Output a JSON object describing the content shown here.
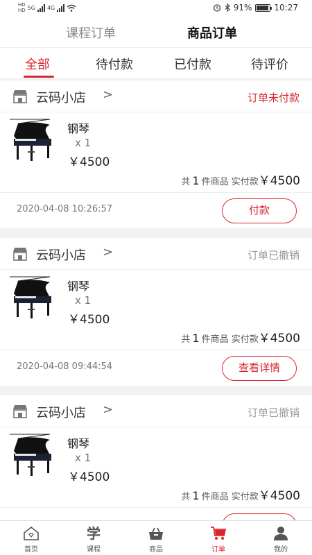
{
  "status_bar": {
    "left_hd_top": "HD",
    "left_hd_bottom": "HD",
    "net_label_1": "5G",
    "net_label_2": "4G",
    "battery_percent": "91%",
    "battery_level": 0.91,
    "time": "10:27"
  },
  "top_tabs": {
    "course_label": "课程订单",
    "goods_label": "商品订单",
    "active": "goods"
  },
  "sub_tabs": [
    {
      "label": "全部",
      "active": true
    },
    {
      "label": "待付款",
      "active": false
    },
    {
      "label": "已付款",
      "active": false
    },
    {
      "label": "待评价",
      "active": false
    }
  ],
  "orders": [
    {
      "shop_name": "云码小店",
      "chevron": ">",
      "status": "订单未付款",
      "status_type": "unpaid",
      "item_name": "钢琴",
      "qty": "x 1",
      "price": "￥4500",
      "summary_prefix": "共",
      "summary_count": "1",
      "summary_mid": "件商品 实付款",
      "summary_amount": "￥4500",
      "time": "2020-04-08 10:26:57",
      "action_label": "付款"
    },
    {
      "shop_name": "云码小店",
      "chevron": ">",
      "status": "订单已撤销",
      "status_type": "cancel",
      "item_name": "钢琴",
      "qty": "x 1",
      "price": "￥4500",
      "summary_prefix": "共",
      "summary_count": "1",
      "summary_mid": "件商品 实付款",
      "summary_amount": "￥4500",
      "time": "2020-04-08 09:44:54",
      "action_label": "查看详情"
    },
    {
      "shop_name": "云码小店",
      "chevron": ">",
      "status": "订单已撤销",
      "status_type": "cancel",
      "item_name": "钢琴",
      "qty": "x 1",
      "price": "￥4500",
      "summary_prefix": "共",
      "summary_count": "1",
      "summary_mid": "件商品 实付款",
      "summary_amount": "￥4500",
      "time": "",
      "action_label": ""
    }
  ],
  "bottom_nav": [
    {
      "label": "首页",
      "icon": "home-icon",
      "active": false
    },
    {
      "label": "课程",
      "icon": "study-icon",
      "glyph": "学",
      "active": false
    },
    {
      "label": "商品",
      "icon": "basket-icon",
      "active": false
    },
    {
      "label": "订单",
      "icon": "cart-icon",
      "active": true
    },
    {
      "label": "我的",
      "icon": "user-icon",
      "active": false
    }
  ],
  "colors": {
    "accent": "#d9262e",
    "muted": "#999999",
    "background": "#f2f2f2"
  }
}
